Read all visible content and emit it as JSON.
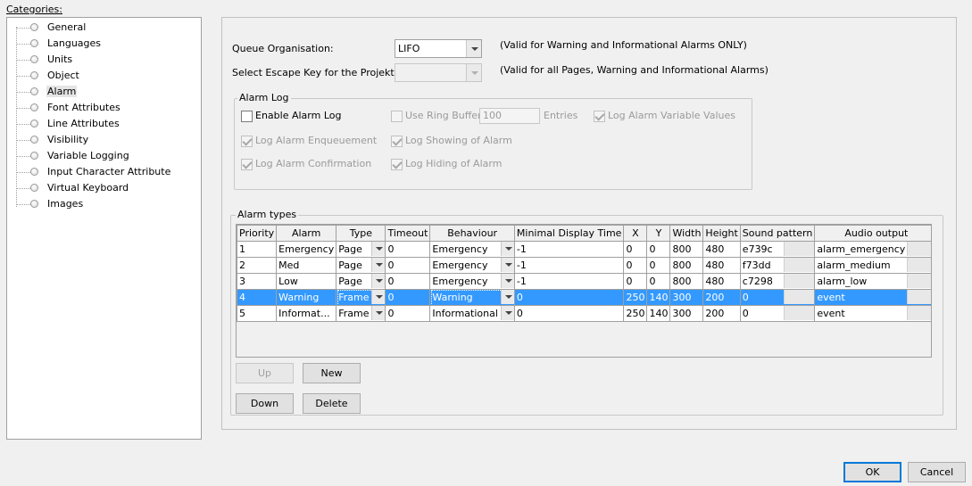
{
  "categories": {
    "title": "Categories:",
    "items": [
      "General",
      "Languages",
      "Units",
      "Object",
      "Alarm",
      "Font Attributes",
      "Line Attributes",
      "Visibility",
      "Variable Logging",
      "Input Character Attribute",
      "Virtual Keyboard",
      "Images"
    ],
    "selected": "Alarm"
  },
  "queue": {
    "label": "Queue Organisation:",
    "value": "LIFO",
    "note": "(Valid for Warning and Informational Alarms ONLY)"
  },
  "escape": {
    "label": "Select Escape Key for the Projekt:",
    "value": "",
    "note": "(Valid for all Pages, Warning and Informational Alarms)"
  },
  "alarm_log": {
    "title": "Alarm Log",
    "enable": {
      "label": "Enable Alarm Log",
      "checked": false
    },
    "ring_buffer": {
      "label": "Use Ring Buffer",
      "checked": false,
      "value": "100",
      "unit": "Entries"
    },
    "log_values": {
      "label": "Log Alarm Variable Values",
      "checked": true
    },
    "enqueue": {
      "label": "Log Alarm Enqueuement",
      "checked": true
    },
    "showing": {
      "label": "Log Showing of Alarm",
      "checked": true
    },
    "confirmation": {
      "label": "Log Alarm Confirmation",
      "checked": true
    },
    "hiding": {
      "label": "Log Hiding of Alarm",
      "checked": true
    }
  },
  "alarm_types": {
    "title": "Alarm types",
    "columns": [
      "Priority",
      "Alarm",
      "Type",
      "Timeout",
      "Behaviour",
      "Minimal Display Time",
      "X",
      "Y",
      "Width",
      "Height",
      "Sound pattern",
      "Audio output"
    ],
    "rows": [
      {
        "priority": "1",
        "alarm": "Emergency",
        "type": "Page",
        "timeout": "0",
        "behaviour": "Emergency",
        "min_time": "-1",
        "x": "0",
        "y": "0",
        "width": "800",
        "height": "480",
        "sound": "e739c",
        "audio": "alarm_emergency"
      },
      {
        "priority": "2",
        "alarm": "Med",
        "type": "Page",
        "timeout": "0",
        "behaviour": "Emergency",
        "min_time": "-1",
        "x": "0",
        "y": "0",
        "width": "800",
        "height": "480",
        "sound": "f73dd",
        "audio": "alarm_medium"
      },
      {
        "priority": "3",
        "alarm": "Low",
        "type": "Page",
        "timeout": "0",
        "behaviour": "Emergency",
        "min_time": "-1",
        "x": "0",
        "y": "0",
        "width": "800",
        "height": "480",
        "sound": "c7298",
        "audio": "alarm_low"
      },
      {
        "priority": "4",
        "alarm": "Warning",
        "type": "Frame",
        "timeout": "0",
        "behaviour": "Warning",
        "min_time": "0",
        "x": "250",
        "y": "140",
        "width": "300",
        "height": "200",
        "sound": "0",
        "audio": "event"
      },
      {
        "priority": "5",
        "alarm": "Informat...",
        "type": "Frame",
        "timeout": "0",
        "behaviour": "Informational",
        "min_time": "0",
        "x": "250",
        "y": "140",
        "width": "300",
        "height": "200",
        "sound": "0",
        "audio": "event"
      }
    ],
    "selected_row": 3
  },
  "buttons": {
    "up": "Up",
    "new": "New",
    "down": "Down",
    "delete": "Delete",
    "ok": "OK",
    "cancel": "Cancel"
  },
  "colors": {
    "selection": "#3399ff",
    "default_button_border": "#0078d7"
  }
}
